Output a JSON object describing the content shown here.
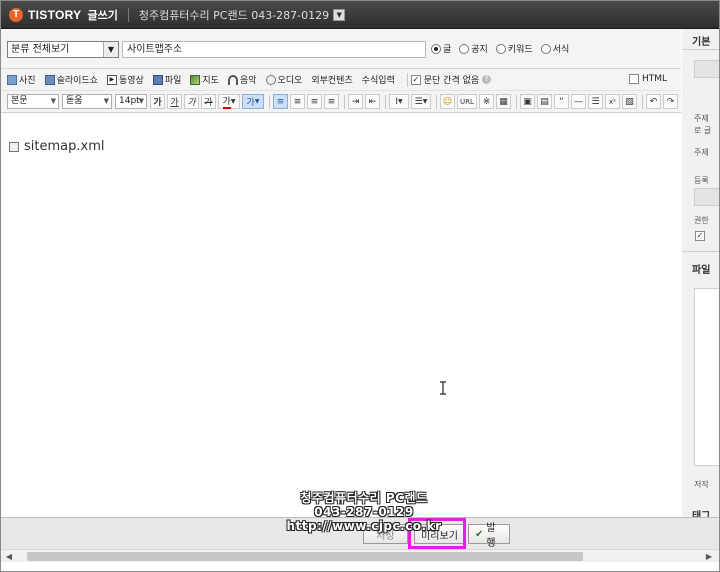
{
  "header": {
    "brand": "TISTORY",
    "mode": "글쓰기",
    "blog_name": "청주컴퓨터수리 PC랜드 043-287-0129"
  },
  "form": {
    "category": "분류 전체보기",
    "title_value": "사이트맵주소",
    "post_types": [
      {
        "label": "글",
        "checked": true
      },
      {
        "label": "공지",
        "checked": false
      },
      {
        "label": "키워드",
        "checked": false
      },
      {
        "label": "서식",
        "checked": false
      }
    ]
  },
  "insert_toolbar": {
    "items": [
      "사진",
      "슬라이드쇼",
      "동영상",
      "파일",
      "지도",
      "음악",
      "오디오",
      "외부컨텐츠",
      "수식입력"
    ],
    "paragraph_spacing": "문단 간격 없음",
    "html_label": "HTML"
  },
  "format_toolbar": {
    "paragraph_style": "본문",
    "font": "돋움",
    "size": "14pt",
    "url_label": "URL"
  },
  "content": {
    "attachment_name": "sitemap.xml"
  },
  "sidebar": {
    "basic_header": "기본",
    "topic_label": "주제",
    "topic_sub": "로 글",
    "topic2_label": "주제",
    "register_label": "등록",
    "permission_label": "권한",
    "file_header": "파일",
    "copyright_label": "저작",
    "tag_header": "태그"
  },
  "bottom": {
    "save_label": "저장",
    "preview_label": "미리보기",
    "publish_label": "발행"
  },
  "watermark": {
    "line1": "청주컴퓨터수리 PC랜드",
    "line2": "043-287-0129",
    "line3": "http://www.cjpc.co.kr"
  },
  "colors": {
    "highlight": "#e61ee0",
    "logo": "#e8642a",
    "titlebar": "#3a3a3a"
  }
}
